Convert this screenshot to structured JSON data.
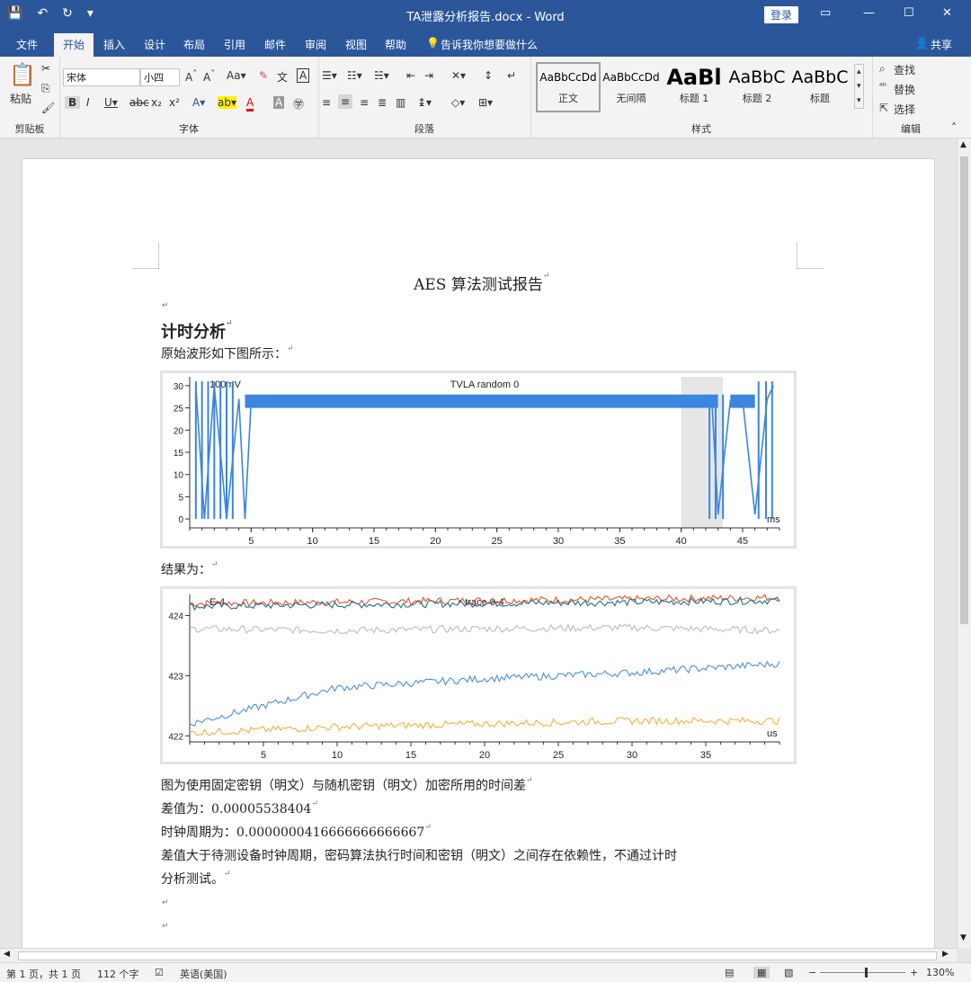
{
  "window": {
    "title": "TA泄露分析报告.docx - Word",
    "login": "登录"
  },
  "tabs": [
    "文件",
    "开始",
    "插入",
    "设计",
    "布局",
    "引用",
    "邮件",
    "审阅",
    "视图",
    "帮助"
  ],
  "tell_me": "告诉我你想要做什么",
  "share": "共享",
  "ribbon": {
    "paste": "粘贴",
    "clipboard": "剪贴板",
    "font_name": "宋体",
    "font_size": "小四",
    "font_group": "字体",
    "paragraph_group": "段落",
    "styles_group": "样式",
    "editing_group": "编辑",
    "find": "查找",
    "replace": "替换",
    "select": "选择",
    "styles": [
      {
        "preview": "AaBbCcDd",
        "name": "正文"
      },
      {
        "preview": "AaBbCcDd",
        "name": "无间隔"
      },
      {
        "preview": "AaBl",
        "name": "标题 1"
      },
      {
        "preview": "AaBbC",
        "name": "标题 2"
      },
      {
        "preview": "AaBbC",
        "name": "标题"
      }
    ]
  },
  "document": {
    "title": "AES 算法测试报告",
    "heading": "计时分析",
    "p1": "原始波形如下图所示：",
    "p2": "结果为：",
    "p3": "图为使用固定密钥（明文）与随机密钥（明文）加密所用的时间差",
    "p4": "差值为：0.00005538404",
    "p5": "时钟周期为：0.0000000416666666666667",
    "p6a": "差值大于待测设备时钟周期，密码算法执行时间和密钥（明文）之间存在依赖性，不通过计时",
    "p6b": "分析测试。"
  },
  "chart_data": [
    {
      "type": "line",
      "title": "TVLA random 0",
      "scale_label": "100mV",
      "unit": "ms",
      "xlim": [
        0,
        48
      ],
      "ylim": [
        -2,
        32
      ],
      "x_ticks": [
        5,
        10,
        15,
        20,
        25,
        30,
        35,
        40,
        45
      ],
      "y_ticks": [
        0,
        5,
        10,
        15,
        20,
        25,
        30
      ],
      "highlight": [
        40,
        43.4
      ],
      "series": [
        {
          "color": "#3a86e0",
          "x": [
            0.5,
            1.2,
            2,
            3,
            4,
            4.5,
            5,
            10,
            15,
            20,
            25,
            30,
            35,
            40,
            42.5,
            43,
            44,
            45,
            46,
            47,
            47.5
          ],
          "y": [
            30,
            0,
            30,
            0,
            27,
            0,
            26.5,
            26.8,
            26.7,
            26.8,
            26.7,
            26.8,
            26.7,
            26.8,
            26.6,
            1,
            26.6,
            26.8,
            1,
            27,
            30
          ]
        }
      ]
    },
    {
      "type": "line",
      "title": "trace 0-4",
      "scale_label": "E-4",
      "unit": "us",
      "xlim": [
        0,
        40
      ],
      "ylim": [
        421.9,
        424.35
      ],
      "x_ticks": [
        5,
        10,
        15,
        20,
        25,
        30,
        35
      ],
      "y_ticks": [
        422,
        423,
        424
      ],
      "series": [
        {
          "color": "#e8542a",
          "x": [
            0,
            10,
            20,
            30,
            40
          ],
          "y": [
            424.2,
            424.22,
            424.25,
            424.27,
            424.3
          ]
        },
        {
          "color": "#1f6e8c",
          "x": [
            0,
            10,
            20,
            30,
            40
          ],
          "y": [
            424.15,
            424.18,
            424.2,
            424.22,
            424.25
          ]
        },
        {
          "color": "#bdbdbd",
          "x": [
            0,
            10,
            20,
            30,
            40
          ],
          "y": [
            423.78,
            423.75,
            423.78,
            423.8,
            423.75
          ]
        },
        {
          "color": "#4a8ee6",
          "x": [
            0,
            10,
            20,
            30,
            40
          ],
          "y": [
            422.2,
            422.8,
            422.95,
            423.05,
            423.2
          ]
        },
        {
          "color": "#f5b041",
          "x": [
            0,
            10,
            20,
            30,
            40
          ],
          "y": [
            422.05,
            422.15,
            422.2,
            422.25,
            422.25
          ]
        }
      ]
    }
  ],
  "status": {
    "page": "第 1 页，共 1 页",
    "words": "112 个字",
    "lang": "英语(美国)",
    "zoom": "130%"
  }
}
